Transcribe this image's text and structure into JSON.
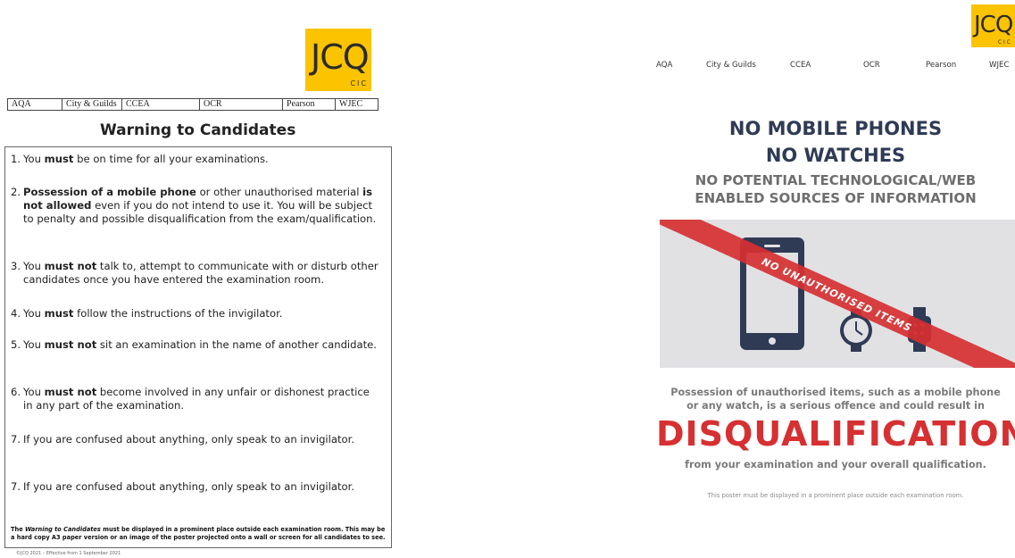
{
  "left": {
    "logo": {
      "main": "JCQ",
      "sub": "CIC"
    },
    "boards": [
      "AQA",
      "City & Guilds",
      "CCEA",
      "OCR",
      "Pearson",
      "WJEC"
    ],
    "title": "Warning to Candidates",
    "rules": [
      {
        "num": "1.",
        "pre": "You ",
        "bold": "must",
        "post": " be on time for all your examinations."
      },
      {
        "num": "2.",
        "bold1": "Possession of a mobile phone",
        "mid": " or other unauthorised material ",
        "bold2": "is not allowed",
        "post": " even if you do not intend to use it. You will be subject to penalty and possible disqualification from the exam/qualification."
      },
      {
        "num": "3.",
        "pre": "You ",
        "bold": "must not",
        "post": " talk to, attempt to communicate with or disturb other candidates once you have entered the examination room."
      },
      {
        "num": "4.",
        "pre": "You ",
        "bold": "must",
        "post": " follow the instructions of the invigilator."
      },
      {
        "num": "5.",
        "pre": "You ",
        "bold": "must not",
        "post": " sit an examination in the name of another candidate."
      },
      {
        "num": "6.",
        "pre": "You ",
        "bold": "must not",
        "post": " become involved in any unfair or dishonest practice in any part of the examination."
      },
      {
        "num": "7.",
        "pre": "If you are confused about anything, only speak to an invigilator.",
        "bold": "",
        "post": ""
      }
    ],
    "footnote": {
      "pre": "The ",
      "italic": "Warning to Candidates",
      "post": " must be displayed in a prominent place outside each examination room. This may be a hard copy A3 paper version or an image of the poster projected onto a wall or screen for all candidates to see."
    },
    "copyright": "©JCQ 2021 – Effective from 1 September 2021"
  },
  "right": {
    "logo": {
      "main": "JCQ",
      "sub": "CIC"
    },
    "boards": [
      "AQA",
      "City & Guilds",
      "CCEA",
      "OCR",
      "Pearson",
      "WJEC"
    ],
    "headline1": "NO MOBILE PHONES",
    "headline2": "NO WATCHES",
    "subhead1": "NO POTENTIAL TECHNOLOGICAL/WEB",
    "subhead2": "ENABLED SOURCES OF INFORMATION",
    "banner_text": "NO UNAUTHORISED ITEMS",
    "body_line1": "Possession of unauthorised items, such as a mobile phone",
    "body_line2": "or any watch, is a serious offence and could result in",
    "disqualification": "DISQUALIFICATION",
    "body_line3": "from your examination and your overall qualification.",
    "note": "This poster must be displayed in a prominent place outside each examination room.",
    "colors": {
      "navy": "#2f3a55",
      "red": "#d63032",
      "grey": "#e1e1e4",
      "logo_yellow": "#fcc300"
    },
    "icons": [
      "mobile-phone-icon",
      "analog-watch-icon",
      "smart-watch-icon"
    ]
  }
}
